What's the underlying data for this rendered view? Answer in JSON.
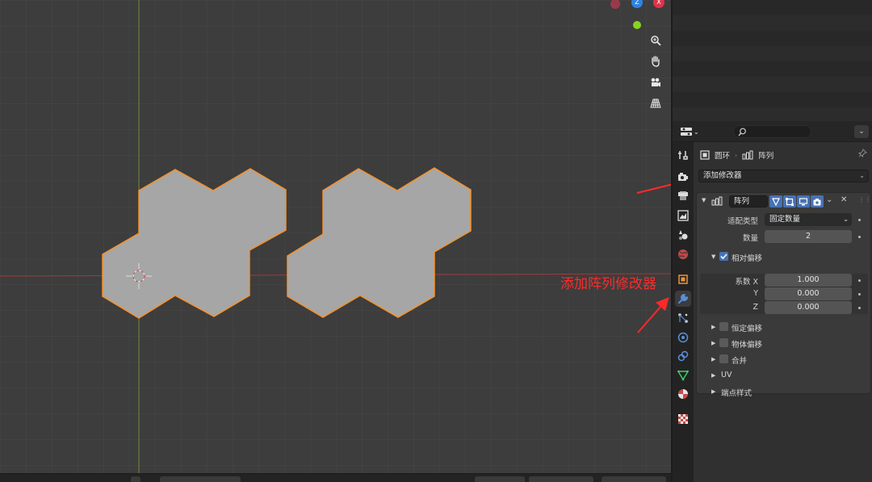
{
  "annotation": {
    "text": "添加阵列修改器"
  },
  "properties": {
    "breadcrumb": {
      "object": "圆环",
      "modifier": "阵列"
    },
    "add_modifier_label": "添加修改器",
    "modifier": {
      "name": "阵列",
      "fit_type_label": "适配类型",
      "fit_type_value": "固定数量",
      "count_label": "数量",
      "count_value": "2",
      "relative_offset_label": "相对偏移",
      "relative_offset_enabled": true,
      "factor_x_label": "系数 X",
      "factor_x_value": "1.000",
      "factor_y_label": "Y",
      "factor_y_value": "0.000",
      "factor_z_label": "Z",
      "factor_z_value": "0.000",
      "subpanels": [
        {
          "label": "恒定偏移",
          "checkbox": true
        },
        {
          "label": "物体偏移",
          "checkbox": true
        },
        {
          "label": "合并",
          "checkbox": true
        },
        {
          "label": "UV",
          "checkbox": false
        },
        {
          "label": "端点样式",
          "checkbox": false
        }
      ]
    }
  },
  "gizmo": {
    "z_label": "Z",
    "x_label": "X"
  },
  "colors": {
    "selection_outline": "#f5922c",
    "mesh_face": "#a6a6a6",
    "x_axis": "#d43a3a",
    "y_axis_line": "#7a9a3a",
    "annotation": "#ff2a2a",
    "accent": "#4772b3"
  }
}
